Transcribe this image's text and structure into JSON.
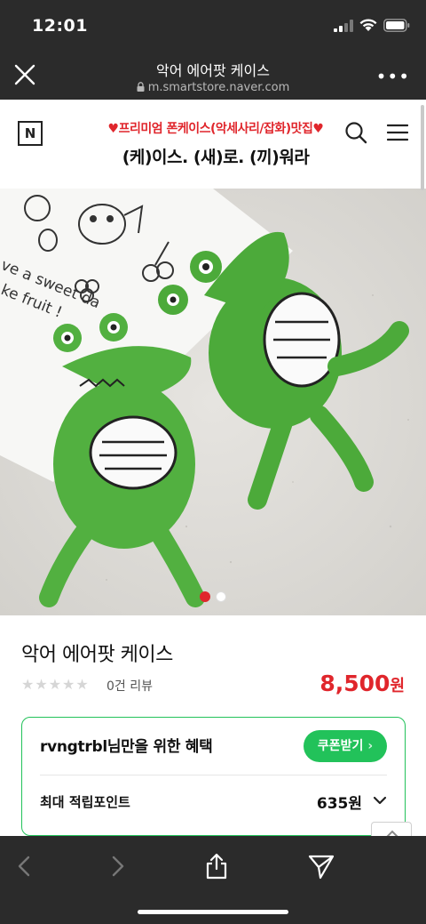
{
  "status_bar": {
    "time": "12:01"
  },
  "browser": {
    "page_title": "악어 에어팟 케이스",
    "url": "m.smartstore.naver.com"
  },
  "store": {
    "logo": "N",
    "banner_line1": "♥프리미엄 폰케이스(악세사리/잡화)맛집♥",
    "banner_line2": "(케)이스. (새)로. (끼)워라"
  },
  "product": {
    "title": "악어 에어팟 케이스",
    "stars": "★★★★★",
    "review_count": "0건 리뷰",
    "price": "8,500",
    "price_unit": "원",
    "image_count": 2,
    "current_image": 1
  },
  "benefit": {
    "title": "rvngtrbl님만을 위한 혜택",
    "coupon_label": "쿠폰받기",
    "coupon_arrow": "›",
    "point_label": "최대 적립포인트",
    "point_value": "635원"
  },
  "colors": {
    "accent_red": "#e0262c",
    "naver_green": "#22c25a",
    "chrome_dark": "#2b2b2b"
  },
  "icons": [
    "signal-icon",
    "wifi-icon",
    "battery-icon",
    "close-icon",
    "lock-icon",
    "more-icon",
    "search-icon",
    "menu-icon",
    "chevron-down-icon",
    "chevron-up-icon",
    "back-icon",
    "forward-icon",
    "share-icon",
    "send-icon"
  ]
}
